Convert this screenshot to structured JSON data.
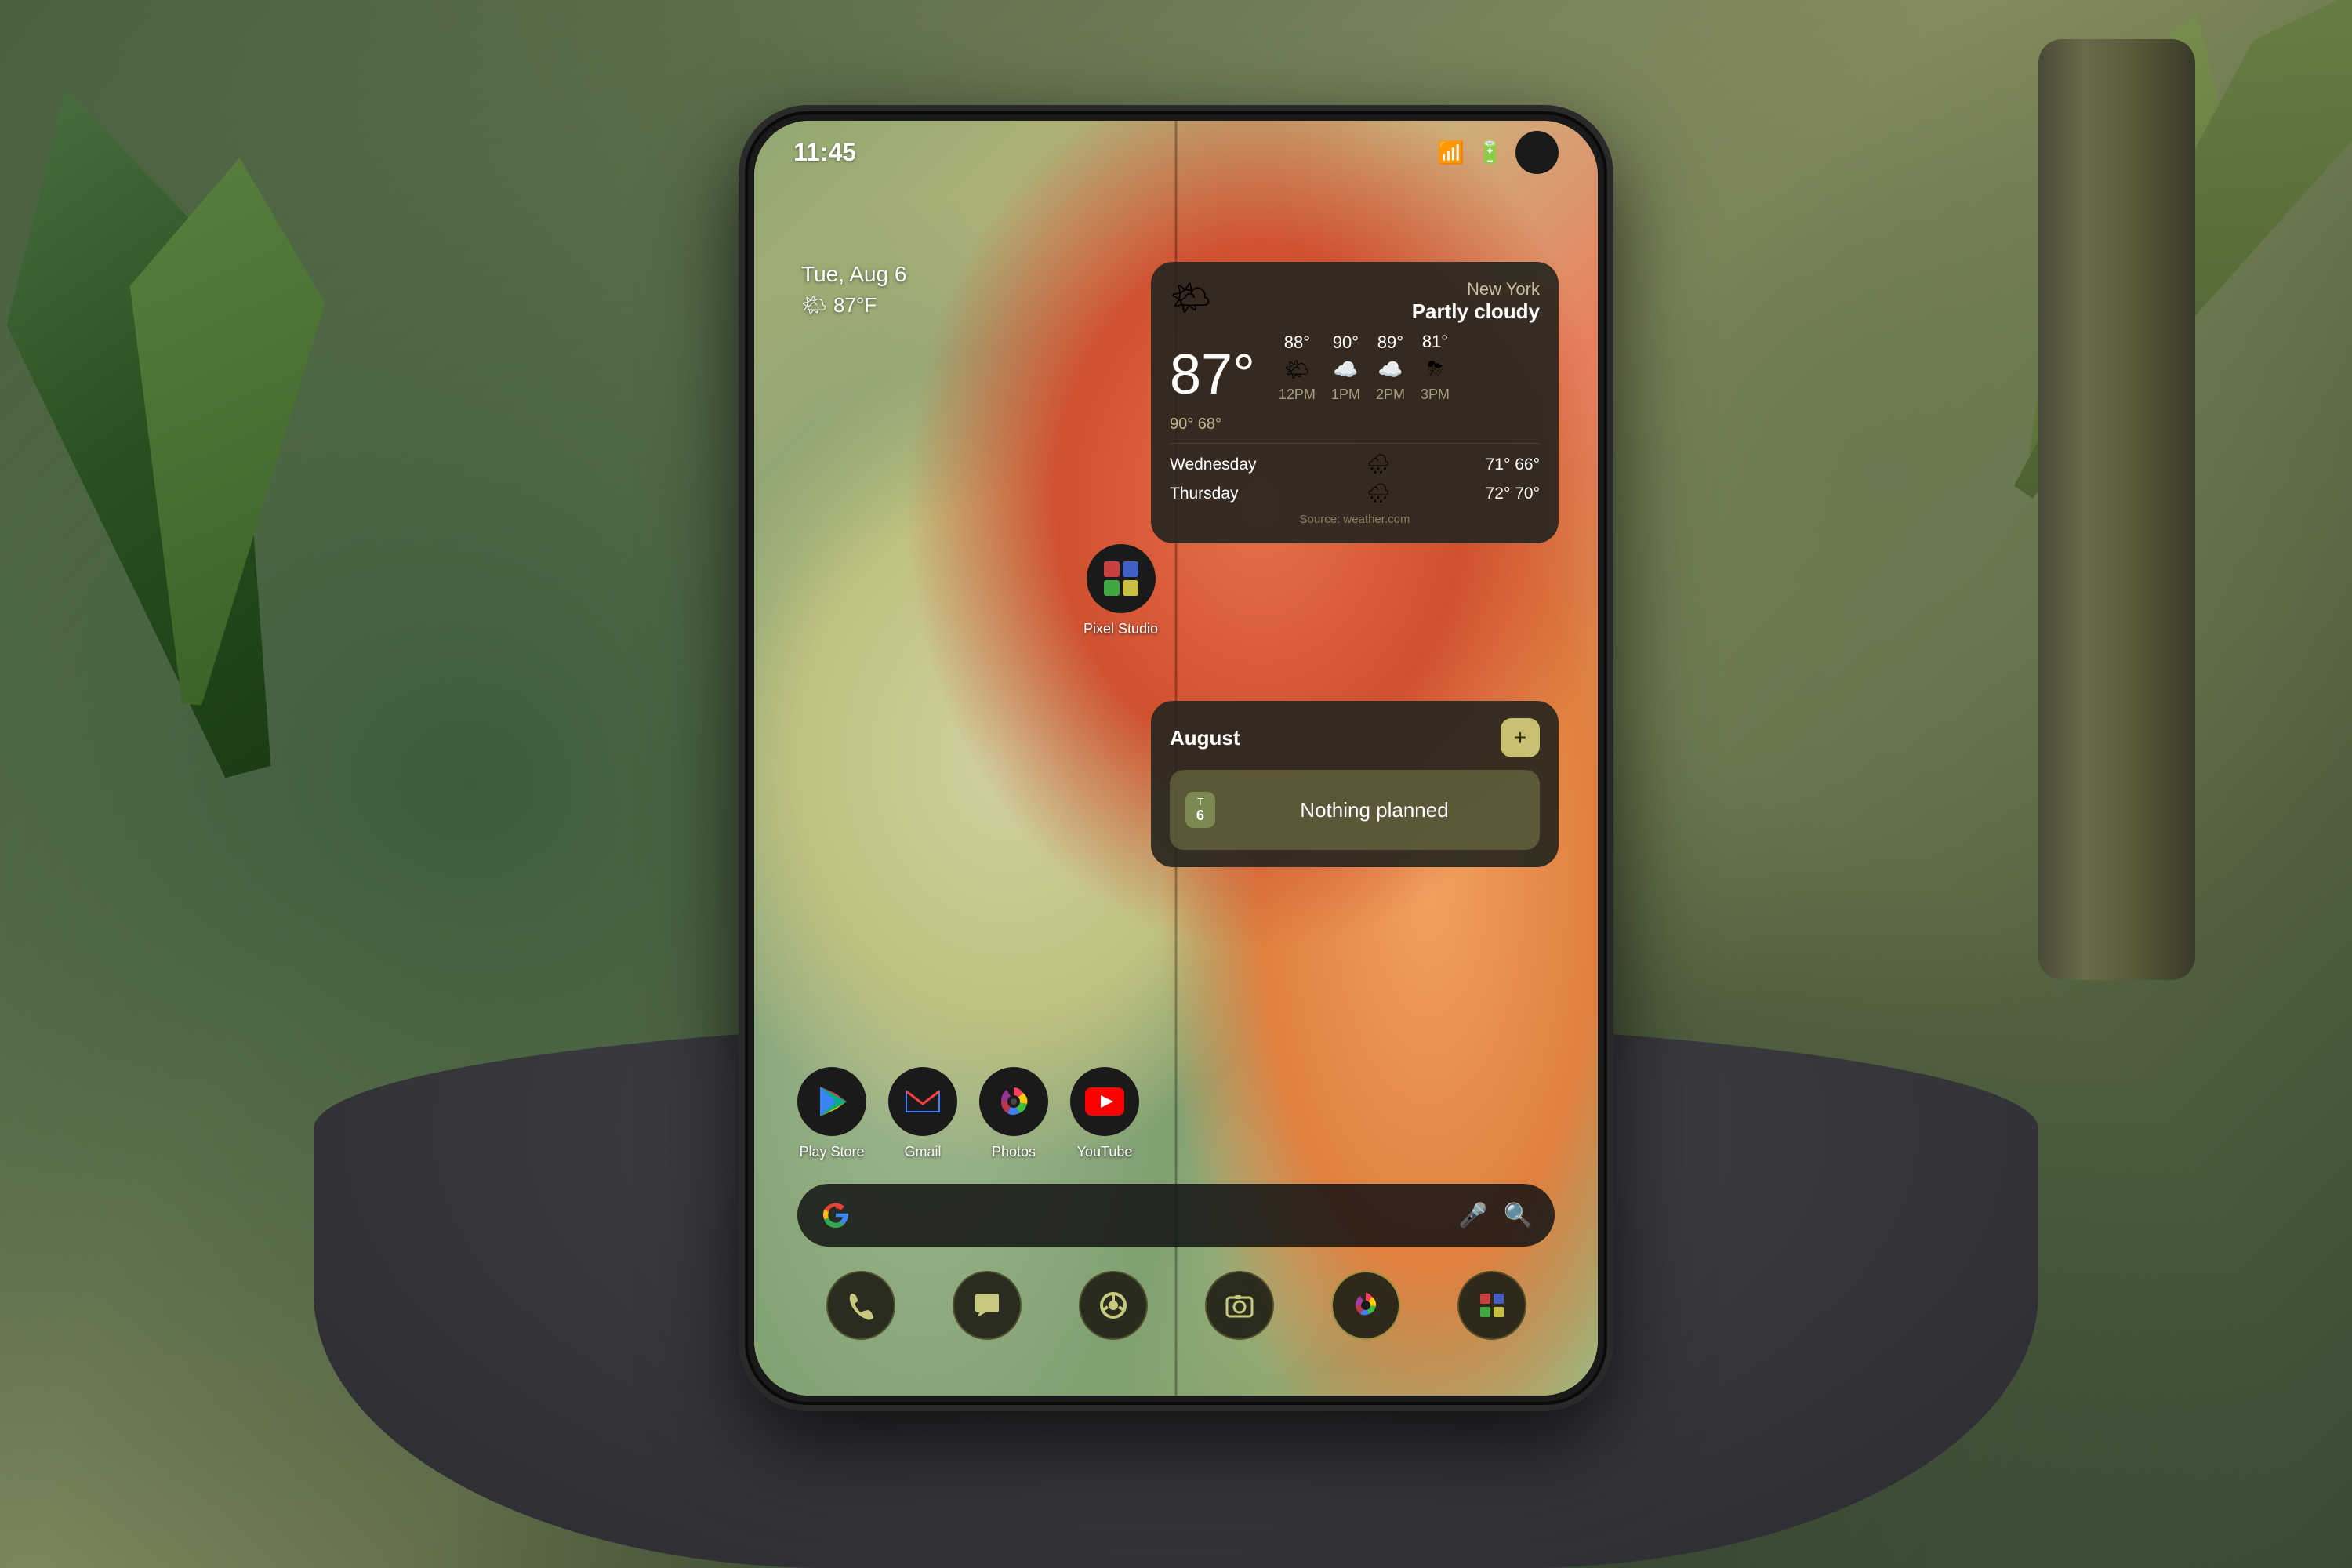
{
  "scene": {
    "title": "Android Phone Home Screen"
  },
  "statusBar": {
    "time": "11:45",
    "wifiIcon": "📶",
    "batteryIcon": "🔋"
  },
  "dateWidget": {
    "date": "Tue, Aug 6",
    "weatherSmall": "🌤 87°F"
  },
  "weatherWidget": {
    "location": "New York",
    "condition": "Partly cloudy",
    "currentTemp": "87°",
    "tempRange": "90° 68°",
    "source": "Source: weather.com",
    "hourly": [
      {
        "time": "12PM",
        "temp": "88°",
        "icon": "🌤"
      },
      {
        "time": "1PM",
        "temp": "90°",
        "icon": "☁️"
      },
      {
        "time": "2PM",
        "temp": "89°",
        "icon": "☁️"
      },
      {
        "time": "3PM",
        "temp": "81°",
        "icon": "⛈"
      }
    ],
    "daily": [
      {
        "day": "Wednesday",
        "icon": "🌧",
        "high": "71°",
        "low": "66°"
      },
      {
        "day": "Thursday",
        "icon": "🌧",
        "high": "72°",
        "low": "70°"
      }
    ]
  },
  "calendarWidget": {
    "month": "August",
    "addButtonLabel": "+",
    "dayLetter": "T",
    "dayNumber": "6",
    "nothingPlanned": "Nothing planned"
  },
  "apps": [
    {
      "name": "Play Store",
      "icon": "▶",
      "iconBg": "#2a2a2a"
    },
    {
      "name": "Gmail",
      "icon": "M",
      "iconBg": "#2a2a2a"
    },
    {
      "name": "Photos",
      "icon": "✿",
      "iconBg": "#2a2a2a"
    },
    {
      "name": "YouTube",
      "icon": "▶",
      "iconBg": "#2a2a2a"
    }
  ],
  "pixelStudio": {
    "name": "Pixel Studio",
    "icon": "🎨"
  },
  "searchBar": {
    "gIcon": "G",
    "micIcon": "🎤",
    "lensIcon": "🔍"
  },
  "dock": [
    {
      "name": "Phone",
      "icon": "📞",
      "active": false
    },
    {
      "name": "Messages",
      "icon": "💬",
      "active": false
    },
    {
      "name": "Chrome",
      "icon": "◎",
      "active": false
    },
    {
      "name": "Camera",
      "icon": "📷",
      "active": false
    },
    {
      "name": "Photos",
      "icon": "✿",
      "active": true
    },
    {
      "name": "Pixel Studio",
      "icon": "🎨",
      "active": false
    }
  ],
  "colors": {
    "widgetBg": "rgba(40, 38, 30, 0.92)",
    "accent": "#c8c070",
    "text": "#ffffff",
    "subtext": "#a0a080"
  }
}
